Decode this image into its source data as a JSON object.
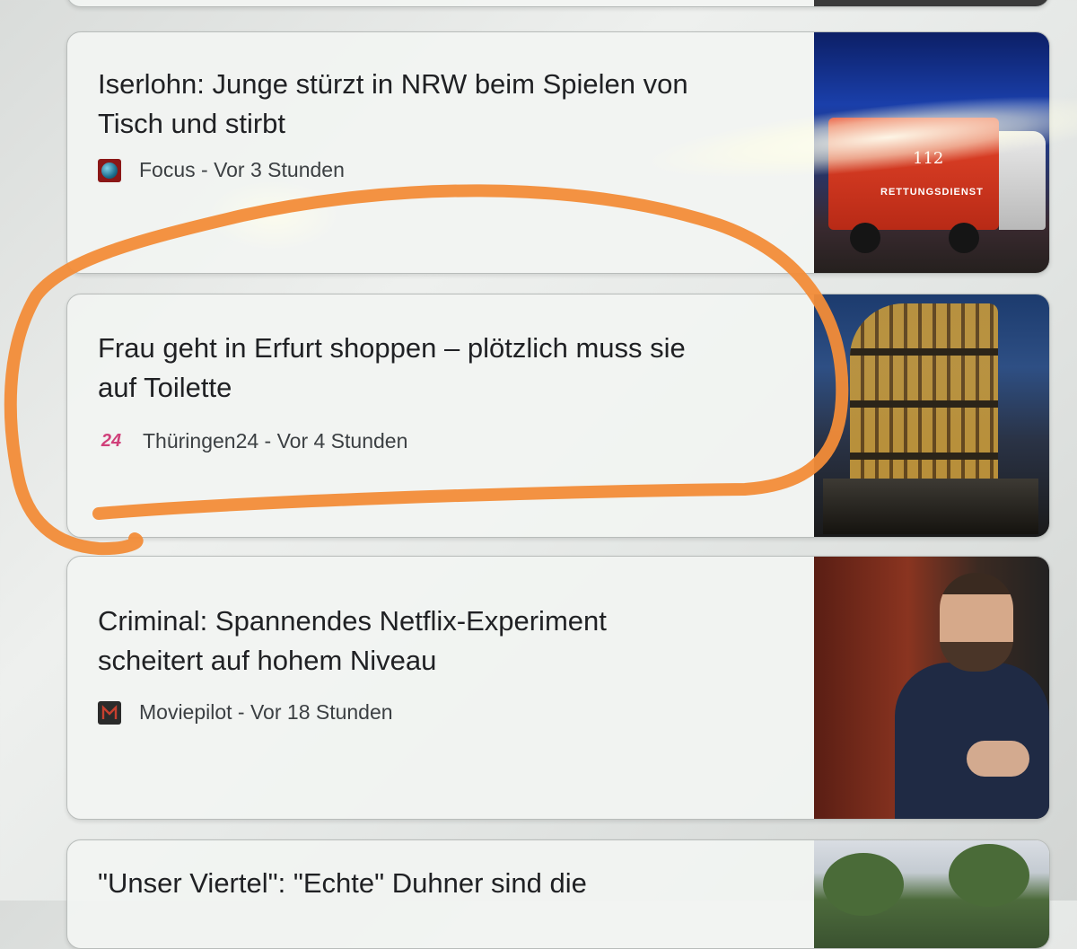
{
  "feed": {
    "articles": [
      {
        "headline": "Iserlohn: Junge stürzt in NRW beim Spielen von Tisch und stirbt",
        "headline_line1": "Iserlohn: Junge stürzt in NRW beim Spielen von",
        "headline_line2": "Tisch und stirbt",
        "source": "Focus",
        "time": "Vor 3 Stunden",
        "meta": "Focus - Vor 3 Stunden",
        "logo_icon": "focus-globe-icon",
        "thumbnail": "ambulance-image",
        "thumbnail_text": "RETTUNGSDIENST",
        "thumbnail_number": "112"
      },
      {
        "headline": "Frau geht in Erfurt shoppen – plötzlich muss sie auf Toilette",
        "headline_line1": "Frau geht in Erfurt shoppen – plötzlich muss sie",
        "headline_line2": "auf Toilette",
        "source": "Thüringen24",
        "time": "Vor 4 Stunden",
        "meta": "Thüringen24 - Vor 4 Stunden",
        "logo_text": "24",
        "logo_icon": "thueringen24-logo-icon",
        "thumbnail": "building-image",
        "highlighted": true
      },
      {
        "headline": "Criminal: Spannendes Netflix-Experiment scheitert auf hohem Niveau",
        "headline_line1": "Criminal: Spannendes Netflix-Experiment",
        "headline_line2": "scheitert auf hohem Niveau",
        "source": "Moviepilot",
        "time": "Vor 18 Stunden",
        "meta": "Moviepilot - Vor 18 Stunden",
        "logo_icon": "moviepilot-logo-icon",
        "thumbnail": "portrait-image"
      },
      {
        "headline_partial": "\"Unser Viertel\": \"Echte\" Duhner sind die",
        "thumbnail": "street-image"
      }
    ]
  },
  "annotation": {
    "color": "#f28c38",
    "shape": "hand-drawn-loop"
  }
}
